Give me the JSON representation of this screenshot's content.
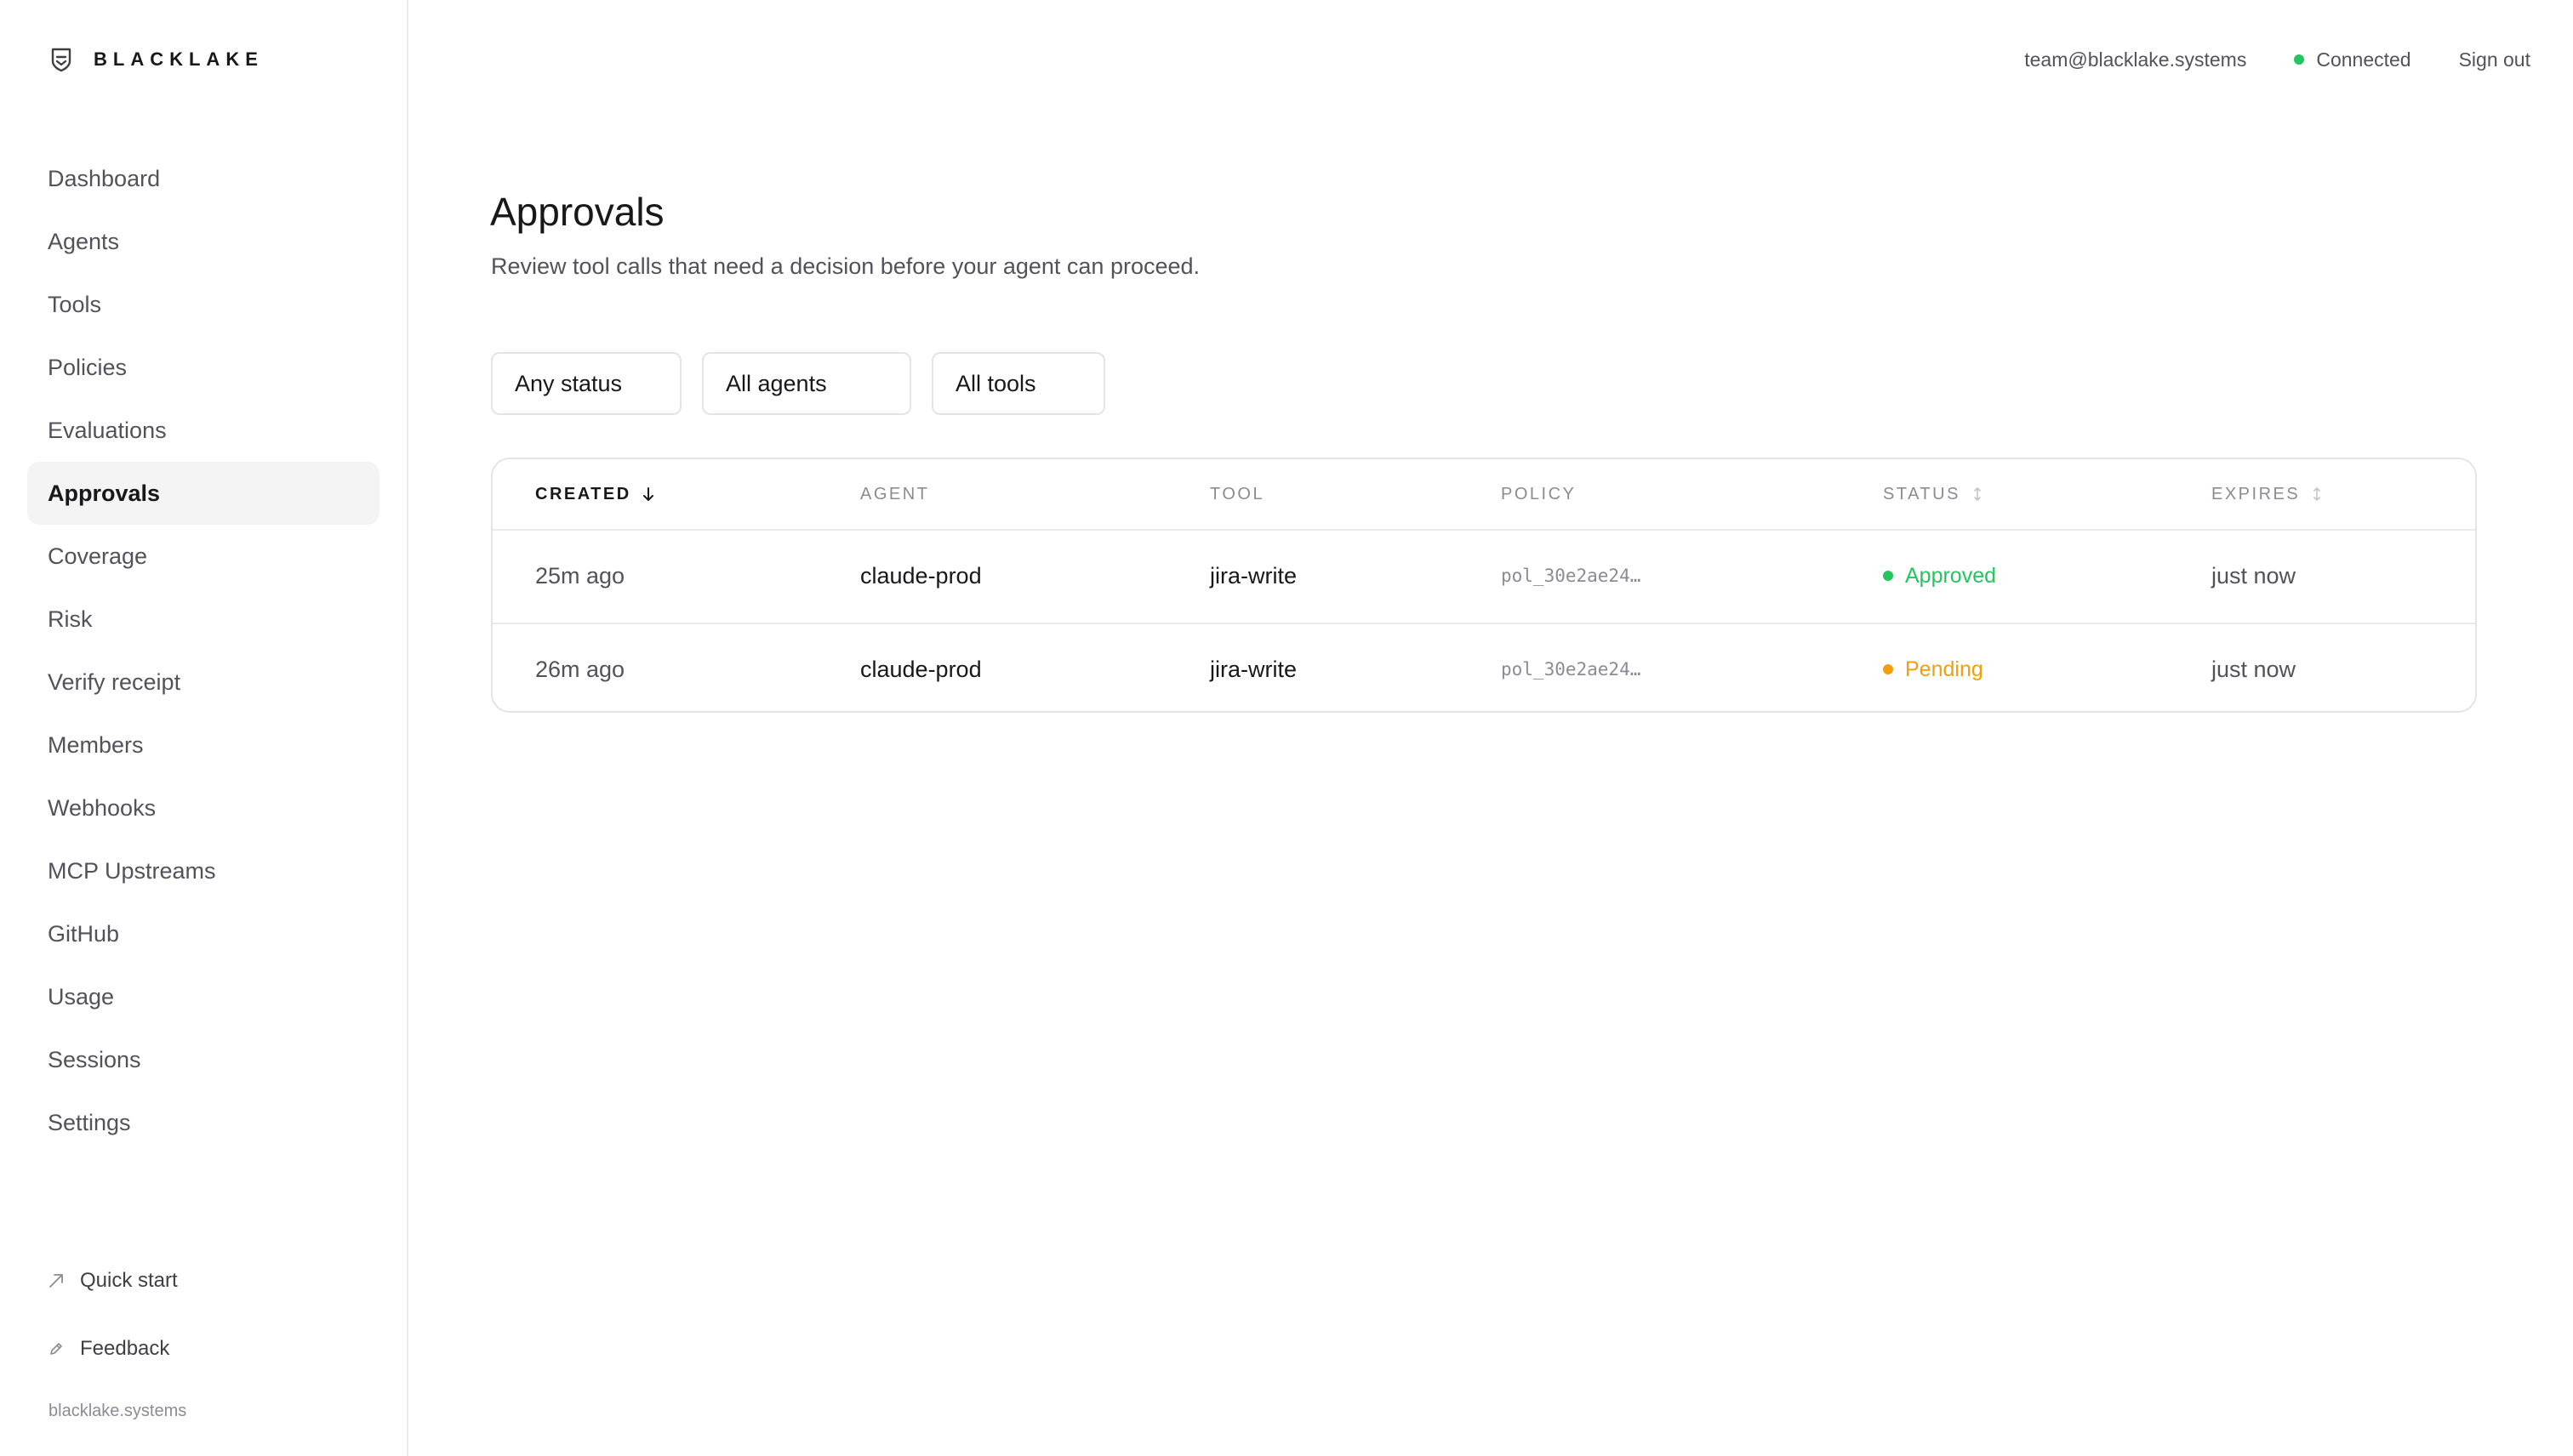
{
  "brand": {
    "name": "BLACKLAKE",
    "icon": "shield-logo-icon"
  },
  "sidebar": {
    "items": [
      {
        "label": "Dashboard",
        "active": false
      },
      {
        "label": "Agents",
        "active": false
      },
      {
        "label": "Tools",
        "active": false
      },
      {
        "label": "Policies",
        "active": false
      },
      {
        "label": "Evaluations",
        "active": false
      },
      {
        "label": "Approvals",
        "active": true
      },
      {
        "label": "Coverage",
        "active": false
      },
      {
        "label": "Risk",
        "active": false
      },
      {
        "label": "Verify receipt",
        "active": false
      },
      {
        "label": "Members",
        "active": false
      },
      {
        "label": "Webhooks",
        "active": false
      },
      {
        "label": "MCP Upstreams",
        "active": false
      },
      {
        "label": "GitHub",
        "active": false
      },
      {
        "label": "Usage",
        "active": false
      },
      {
        "label": "Sessions",
        "active": false
      },
      {
        "label": "Settings",
        "active": false
      }
    ],
    "quick_start": {
      "label": "Quick start",
      "icon": "arrow-up-right-icon"
    },
    "feedback": {
      "label": "Feedback",
      "icon": "pencil-icon"
    },
    "footer": "blacklake.systems"
  },
  "topbar": {
    "email": "team@blacklake.systems",
    "connection": "Connected",
    "connection_color": "#22c55e",
    "sign_out": "Sign out"
  },
  "page": {
    "title": "Approvals",
    "subtitle": "Review tool calls that need a decision before your agent can proceed."
  },
  "filters": {
    "status": "Any status",
    "agents": "All agents",
    "tools": "All tools"
  },
  "table": {
    "columns": [
      {
        "label": "CREATED",
        "sort": "desc"
      },
      {
        "label": "AGENT",
        "sort": ""
      },
      {
        "label": "TOOL",
        "sort": ""
      },
      {
        "label": "POLICY",
        "sort": ""
      },
      {
        "label": "STATUS",
        "sort": "sortable"
      },
      {
        "label": "EXPIRES",
        "sort": "sortable"
      }
    ],
    "rows": [
      {
        "created": "25m ago",
        "agent": "claude-prod",
        "tool": "jira-write",
        "policy": "pol_30e2ae24…",
        "status": "Approved",
        "status_color": "#22c55e",
        "expires": "just now"
      },
      {
        "created": "26m ago",
        "agent": "claude-prod",
        "tool": "jira-write",
        "policy": "pol_30e2ae24…",
        "status": "Pending",
        "status_color": "#f59e0b",
        "expires": "just now"
      }
    ]
  }
}
